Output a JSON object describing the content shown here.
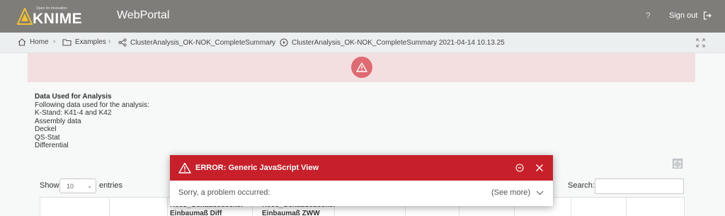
{
  "header": {
    "logo_tagline": "Open for Innovation",
    "logo_word": "KNIME",
    "app_title": "WebPortal",
    "help_label": "?",
    "signout_label": "Sign out"
  },
  "breadcrumb": {
    "items": [
      {
        "label": "Home",
        "icon": "home-icon"
      },
      {
        "label": "Examples",
        "icon": "folder-icon"
      },
      {
        "label": "ClusterAnalysis_OK-NOK_CompleteSummary",
        "icon": "workflow-icon"
      },
      {
        "label": "ClusterAnalysis_OK-NOK_CompleteSummary 2021-04-14 10.13.25",
        "icon": "play-circle-icon"
      }
    ],
    "separator": "›"
  },
  "content": {
    "heading": "Data Used for Analysis",
    "lines": [
      "Following data used for the analysis:",
      "K-Stand: K41-4 and K42",
      "Assembly data",
      "Deckel",
      "QS-Stat",
      "Differential"
    ]
  },
  "table_controls": {
    "show_label": "Show",
    "entries_value": "10",
    "entries_label": "entries",
    "search_label": "Search:",
    "search_value": ""
  },
  "table": {
    "visible_headers": [
      [
        "H005_Gehäusedeckel",
        "Einbaumaß Diff"
      ],
      [
        "H005_Gehäusedeckel",
        "Einbaumaß ZWW"
      ]
    ]
  },
  "error_dialog": {
    "title": "ERROR: Generic JavaScript View",
    "message": "Sorry, a problem occurred:",
    "see_more_label": "(See more)"
  },
  "colors": {
    "topbar": "#7f7d7a",
    "error_red": "#c8202a",
    "warning_band": "#f3dfe0",
    "warning_circle": "#e06a72"
  }
}
